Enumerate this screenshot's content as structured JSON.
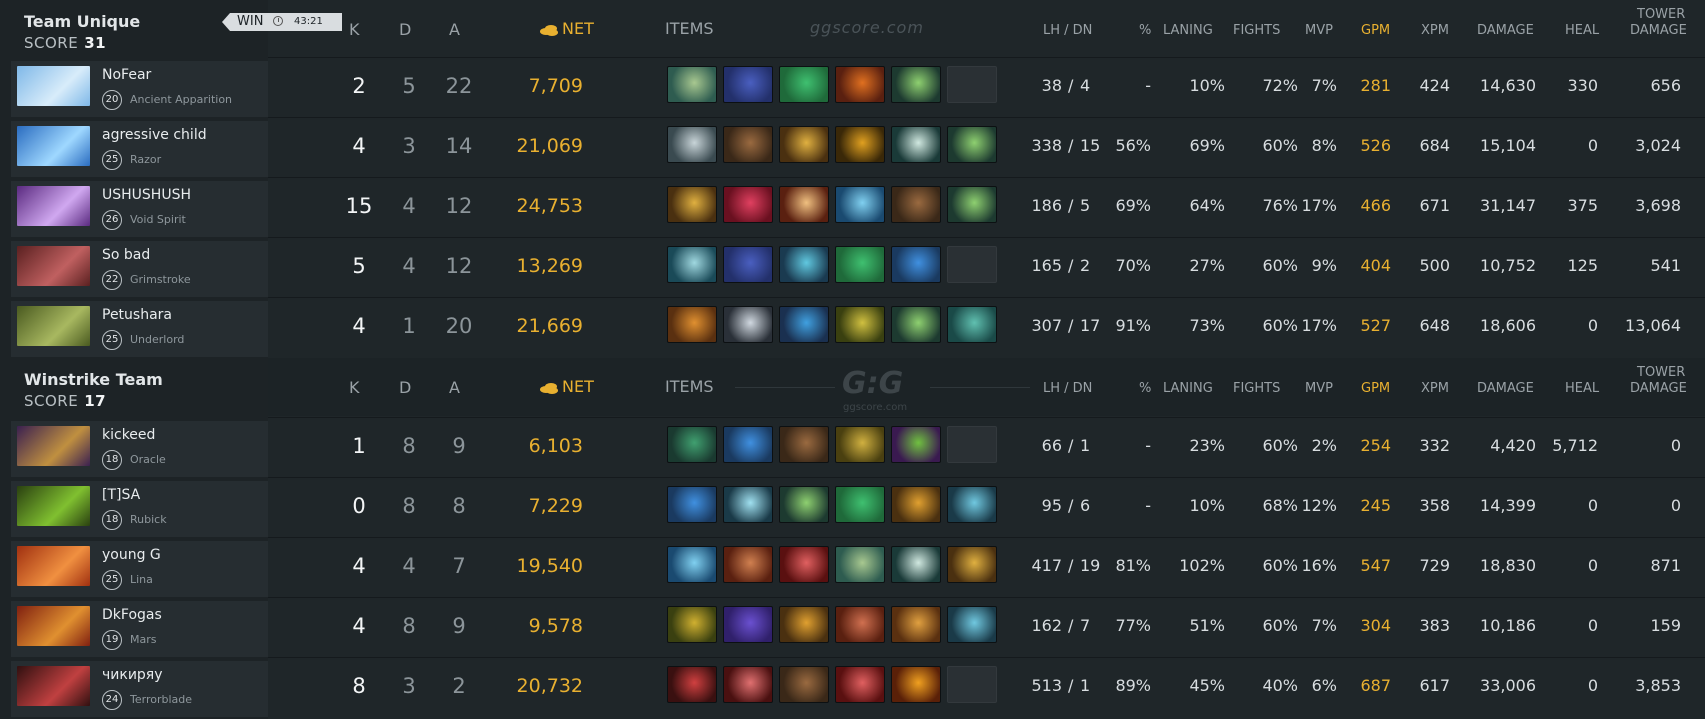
{
  "header": {
    "k": "K",
    "d": "D",
    "a": "A",
    "net": "NET",
    "items": "ITEMS",
    "lhdn": "LH  /  DN",
    "pct": "%",
    "laning": "LANING",
    "fights": "FIGHTS",
    "mvp": "MVP",
    "gpm": "GPM",
    "xpm": "XPM",
    "damage": "DAMAGE",
    "heal": "HEAL",
    "tower1": "TOWER",
    "tower2": "DAMAGE",
    "watermark": "ggscore.com",
    "gg_logo": "G:G",
    "gg_sub": "ggscore.com"
  },
  "result": {
    "label": "WIN",
    "time": "43:21"
  },
  "teams": [
    {
      "name": "Team Unique",
      "score_label": "SCORE",
      "score": "31",
      "players": [
        {
          "name": "NoFear",
          "level": "20",
          "hero": "Ancient Apparition",
          "k": "2",
          "d": "5",
          "a": "22",
          "net": "7,709",
          "lh": "38",
          "dn": "4",
          "pct": "-",
          "laning": "10%",
          "fights": "72%",
          "mvp": "7%",
          "gpm": "281",
          "xpm": "424",
          "damage": "14,630",
          "heal": "330",
          "tower": "656",
          "portrait": [
            "#7fb8e8",
            "#d8ecfa"
          ],
          "items": [
            [
              "#2e5c50",
              "#a8c890"
            ],
            [
              "#23306b",
              "#4a5fc0"
            ],
            [
              "#1f6a3a",
              "#3fc070"
            ],
            [
              "#5a2010",
              "#e07020"
            ],
            [
              "#1d3a30",
              "#8ed070"
            ],
            null
          ]
        },
        {
          "name": "agressive child",
          "level": "25",
          "hero": "Razor",
          "k": "4",
          "d": "3",
          "a": "14",
          "net": "21,069",
          "lh": "338",
          "dn": "15",
          "pct": "56%",
          "laning": "69%",
          "fights": "60%",
          "mvp": "8%",
          "gpm": "526",
          "xpm": "684",
          "damage": "15,104",
          "heal": "0",
          "tower": "3,024",
          "portrait": [
            "#2a6cc0",
            "#9fd8ff"
          ],
          "items": [
            [
              "#3a4a50",
              "#c8d4d8"
            ],
            [
              "#3a2818",
              "#9a6a40"
            ],
            [
              "#4a3010",
              "#e0b040"
            ],
            [
              "#3a2808",
              "#e0a020"
            ],
            [
              "#1a3a38",
              "#d0e8e0"
            ],
            [
              "#1d3a30",
              "#8ed070"
            ]
          ]
        },
        {
          "name": "USHUSHUSH",
          "level": "26",
          "hero": "Void Spirit",
          "k": "15",
          "d": "4",
          "a": "12",
          "net": "24,753",
          "lh": "186",
          "dn": "5",
          "pct": "69%",
          "laning": "64%",
          "fights": "76%",
          "mvp": "17%",
          "gpm": "466",
          "xpm": "671",
          "damage": "31,147",
          "heal": "375",
          "tower": "3,698",
          "portrait": [
            "#5a2a80",
            "#d0a8f0"
          ],
          "items": [
            [
              "#4a3010",
              "#e0b040"
            ],
            [
              "#6a1020",
              "#e04060"
            ],
            [
              "#5a2010",
              "#f0c080"
            ],
            [
              "#1a4a70",
              "#80d0f0"
            ],
            [
              "#3a2818",
              "#9a6a40"
            ],
            [
              "#1d3a30",
              "#8ed070"
            ]
          ]
        },
        {
          "name": "So bad",
          "level": "22",
          "hero": "Grimstroke",
          "k": "5",
          "d": "4",
          "a": "12",
          "net": "13,269",
          "lh": "165",
          "dn": "2",
          "pct": "70%",
          "laning": "27%",
          "fights": "60%",
          "mvp": "9%",
          "gpm": "404",
          "xpm": "500",
          "damage": "10,752",
          "heal": "125",
          "tower": "541",
          "portrait": [
            "#5a2020",
            "#c06060"
          ],
          "items": [
            [
              "#1a4a58",
              "#a0d8e0"
            ],
            [
              "#23306b",
              "#4a5fc0"
            ],
            [
              "#1a3a50",
              "#60c8e0"
            ],
            [
              "#1f6a3a",
              "#3fc070"
            ],
            [
              "#1a3a60",
              "#4090e0"
            ],
            null
          ]
        },
        {
          "name": "Petushara",
          "level": "25",
          "hero": "Underlord",
          "k": "4",
          "d": "1",
          "a": "20",
          "net": "21,669",
          "lh": "307",
          "dn": "17",
          "pct": "91%",
          "laning": "73%",
          "fights": "60%",
          "mvp": "17%",
          "gpm": "527",
          "xpm": "648",
          "damage": "18,606",
          "heal": "0",
          "tower": "13,064",
          "portrait": [
            "#4a5a20",
            "#a8b860"
          ],
          "items": [
            [
              "#5a3010",
              "#e09030"
            ],
            [
              "#2a3038",
              "#d0d8e0"
            ],
            [
              "#1a3050",
              "#40a0e0"
            ],
            [
              "#3a4010",
              "#d0c040"
            ],
            [
              "#1d3a30",
              "#8ed070"
            ],
            [
              "#1a4a48",
              "#60c0b0"
            ]
          ]
        }
      ]
    },
    {
      "name": "Winstrike Team",
      "score_label": "SCORE",
      "score": "17",
      "players": [
        {
          "name": "kickeed",
          "level": "18",
          "hero": "Oracle",
          "k": "1",
          "d": "8",
          "a": "9",
          "net": "6,103",
          "lh": "66",
          "dn": "1",
          "pct": "-",
          "laning": "23%",
          "fights": "60%",
          "mvp": "2%",
          "gpm": "254",
          "xpm": "332",
          "damage": "4,420",
          "heal": "5,712",
          "tower": "0",
          "portrait": [
            "#3a2050",
            "#c09040"
          ],
          "items": [
            [
              "#1a3a30",
              "#40a070"
            ],
            [
              "#1a3a60",
              "#4090e0"
            ],
            [
              "#3a2818",
              "#9a6a40"
            ],
            [
              "#4a4010",
              "#d0b040"
            ],
            [
              "#3a1a50",
              "#70c040"
            ],
            null
          ]
        },
        {
          "name": "[T]SA",
          "level": "18",
          "hero": "Rubick",
          "k": "0",
          "d": "8",
          "a": "8",
          "net": "7,229",
          "lh": "95",
          "dn": "6",
          "pct": "-",
          "laning": "10%",
          "fights": "68%",
          "mvp": "12%",
          "gpm": "245",
          "xpm": "358",
          "damage": "14,399",
          "heal": "0",
          "tower": "0",
          "portrait": [
            "#2a4010",
            "#80c030"
          ],
          "items": [
            [
              "#1a3a60",
              "#4090e0"
            ],
            [
              "#1a3a48",
              "#a0e0f0"
            ],
            [
              "#1d3a30",
              "#8ed070"
            ],
            [
              "#1f6a3a",
              "#3fc070"
            ],
            [
              "#4a3010",
              "#e0a030"
            ],
            [
              "#1a3a48",
              "#70c8e0"
            ]
          ]
        },
        {
          "name": "young G",
          "level": "25",
          "hero": "Lina",
          "k": "4",
          "d": "4",
          "a": "7",
          "net": "19,540",
          "lh": "417",
          "dn": "19",
          "pct": "81%",
          "laning": "102%",
          "fights": "60%",
          "mvp": "16%",
          "gpm": "547",
          "xpm": "729",
          "damage": "18,830",
          "heal": "0",
          "tower": "871",
          "portrait": [
            "#a03010",
            "#f09040"
          ],
          "items": [
            [
              "#1a4a70",
              "#80d0f0"
            ],
            [
              "#5a2010",
              "#d08050"
            ],
            [
              "#5a1010",
              "#e06060"
            ],
            [
              "#2e5c50",
              "#a8c890"
            ],
            [
              "#1a3a38",
              "#d0e8e0"
            ],
            [
              "#4a3010",
              "#e0b040"
            ]
          ]
        },
        {
          "name": "DkFogas",
          "level": "19",
          "hero": "Mars",
          "k": "4",
          "d": "8",
          "a": "9",
          "net": "9,578",
          "lh": "162",
          "dn": "7",
          "pct": "77%",
          "laning": "51%",
          "fights": "60%",
          "mvp": "7%",
          "gpm": "304",
          "xpm": "383",
          "damage": "10,186",
          "heal": "0",
          "tower": "159",
          "portrait": [
            "#802010",
            "#e09030"
          ],
          "items": [
            [
              "#3a4010",
              "#d0b030"
            ],
            [
              "#30206b",
              "#6a50d0"
            ],
            [
              "#4a3010",
              "#e0a030"
            ],
            [
              "#5a2010",
              "#d07050"
            ],
            [
              "#5a3010",
              "#e0a040"
            ],
            [
              "#1a3a48",
              "#70c8e0"
            ]
          ]
        },
        {
          "name": "чикиряу",
          "level": "24",
          "hero": "Terrorblade",
          "k": "8",
          "d": "3",
          "a": "2",
          "net": "20,732",
          "lh": "513",
          "dn": "1",
          "pct": "89%",
          "laning": "45%",
          "fights": "40%",
          "mvp": "6%",
          "gpm": "687",
          "xpm": "617",
          "damage": "33,006",
          "heal": "0",
          "tower": "3,853",
          "portrait": [
            "#301010",
            "#c04040"
          ],
          "items": [
            [
              "#3a1010",
              "#d04040"
            ],
            [
              "#4a1010",
              "#e07070"
            ],
            [
              "#3a2818",
              "#9a6a40"
            ],
            [
              "#5a1010",
              "#e06060"
            ],
            [
              "#5a2008",
              "#f0a020"
            ],
            null
          ]
        }
      ]
    }
  ]
}
